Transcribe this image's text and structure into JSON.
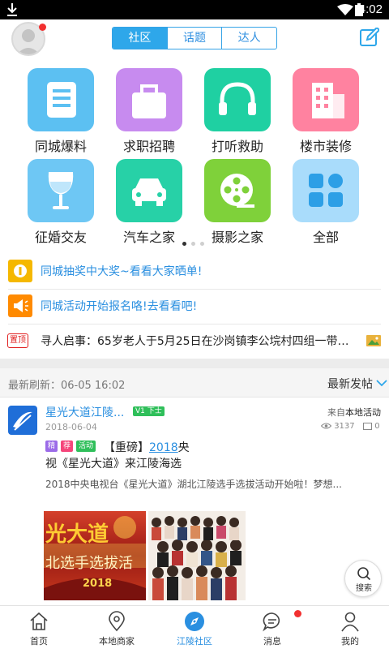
{
  "status": {
    "time": "4:02"
  },
  "header": {
    "tabs": [
      "社区",
      "话题",
      "达人"
    ]
  },
  "categories": [
    {
      "label": "同城爆料",
      "color": "#5cc0f2",
      "icon": "newspaper-icon"
    },
    {
      "label": "求职招聘",
      "color": "#c78bef",
      "icon": "briefcase-icon"
    },
    {
      "label": "打听救助",
      "color": "#1fd0a2",
      "icon": "headphones-icon"
    },
    {
      "label": "楼市装修",
      "color": "#ff82a0",
      "icon": "building-icon"
    },
    {
      "label": "征婚交友",
      "color": "#6ec7f4",
      "icon": "wine-glass-icon"
    },
    {
      "label": "汽车之家",
      "color": "#27d1a7",
      "icon": "car-icon"
    },
    {
      "label": "摄影之家",
      "color": "#7fd13a",
      "icon": "film-reel-icon"
    },
    {
      "label": "全部",
      "color": "#a9dcfb",
      "icon": "grid-icon"
    }
  ],
  "notices": [
    {
      "text": "同城抽奖中大奖~看看大家晒单!",
      "icon_color": "#f5b800",
      "icon": "coin-icon"
    },
    {
      "text": "同城活动开始报名咯!去看看吧!",
      "icon_color": "#ff8a00",
      "icon": "megaphone-icon"
    }
  ],
  "pinned": {
    "badge": "置顶",
    "text": "寻人启事：65岁老人于5月25日在沙岗镇李公垸村四组一带走..."
  },
  "feed": {
    "refresh": "最新刷新：06-05 16:02",
    "sort": "最新发帖"
  },
  "post": {
    "author": "星光大道江陵...",
    "level": "V1 下士",
    "source_prefix": "来自",
    "source": "本地活动",
    "date": "2018-06-04",
    "views": "3137",
    "comments": "0",
    "tags": [
      {
        "text": "精",
        "color": "#9b6be8"
      },
      {
        "text": "荐",
        "color": "#f5457a"
      },
      {
        "text": "活动",
        "color": "#2fbf5a"
      }
    ],
    "title_prefix": "【重磅】",
    "title_link": "2018",
    "title_rest": "央",
    "title_line2": "视《星光大道》来江陵海选",
    "desc": "2018中央电视台《星光大道》湖北江陵选手选拔活动开始啦！梦想...",
    "poster_caption": "2018",
    "poster_lines": [
      "光大道",
      "北选手选拔活"
    ]
  },
  "fab": {
    "label": "搜索"
  },
  "tabbar": [
    {
      "label": "首页",
      "icon": "home-icon"
    },
    {
      "label": "本地商家",
      "icon": "map-pin-icon"
    },
    {
      "label": "江陵社区",
      "icon": "compass-icon"
    },
    {
      "label": "消息",
      "icon": "chat-bubble-icon"
    },
    {
      "label": "我的",
      "icon": "person-icon"
    }
  ],
  "colors": {
    "accent": "#2ea7ea",
    "link": "#2a8fe0",
    "badge": "#f23030"
  }
}
